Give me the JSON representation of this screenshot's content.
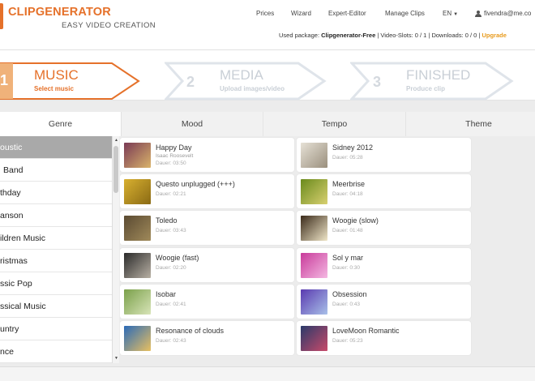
{
  "header": {
    "logo_title": "CLIPGENERATOR",
    "logo_subtitle": "EASY VIDEO CREATION",
    "nav": [
      "Prices",
      "Wizard",
      "Expert-Editor",
      "Manage Clips"
    ],
    "language": "EN",
    "user_email": "fivendra@me.co",
    "package_label": "Used package:",
    "package_name": "Clipgenerator-Free",
    "slots_text": "| Video-Slots: 0 / 1 | Downloads: 0 / 0 |",
    "upgrade_label": "Upgrade"
  },
  "steps": [
    {
      "number": "1",
      "title": "MUSIC",
      "subtitle": "Select music",
      "active": true
    },
    {
      "number": "2",
      "title": "MEDIA",
      "subtitle": "Upload images/video",
      "active": false
    },
    {
      "number": "3",
      "title": "FINISHED",
      "subtitle": "Produce clip",
      "active": false
    }
  ],
  "filters": [
    "Genre",
    "Mood",
    "Tempo",
    "Theme"
  ],
  "genres": [
    {
      "label": "oustic",
      "selected": true
    },
    {
      "label": "Band",
      "selected": false
    },
    {
      "label": "thday",
      "selected": false
    },
    {
      "label": "anson",
      "selected": false
    },
    {
      "label": "ildren Music",
      "selected": false
    },
    {
      "label": "ristmas",
      "selected": false
    },
    {
      "label": "ssic Pop",
      "selected": false
    },
    {
      "label": "ssical Music",
      "selected": false
    },
    {
      "label": "untry",
      "selected": false
    },
    {
      "label": "nce",
      "selected": false
    }
  ],
  "clips": [
    {
      "title": "Happy Day",
      "artist": "Isaac Roosevelt",
      "duration": "Dauer: 03:50",
      "thumb_colors": [
        "#7a3a55",
        "#d9b36a"
      ]
    },
    {
      "title": "Sidney 2012",
      "artist": "",
      "duration": "Dauer: 05:28",
      "thumb_colors": [
        "#e6e1d6",
        "#9a8f7d"
      ]
    },
    {
      "title": "Questo unplugged (+++)",
      "artist": "",
      "duration": "Dauer: 02:21",
      "thumb_colors": [
        "#d8b030",
        "#8a6a14"
      ]
    },
    {
      "title": "Meerbrise",
      "artist": "",
      "duration": "Dauer: 04:18",
      "thumb_colors": [
        "#6a8a1c",
        "#d8d070"
      ]
    },
    {
      "title": "Toledo",
      "artist": "",
      "duration": "Dauer: 03:43",
      "thumb_colors": [
        "#5a4a32",
        "#a08a5a"
      ]
    },
    {
      "title": "Woogie (slow)",
      "artist": "",
      "duration": "Dauer: 01:48",
      "thumb_colors": [
        "#3a2a1a",
        "#f0e6c8"
      ]
    },
    {
      "title": "Woogie (fast)",
      "artist": "",
      "duration": "Dauer: 02:20",
      "thumb_colors": [
        "#2a2a2a",
        "#b8b0a4"
      ]
    },
    {
      "title": "Sol y mar",
      "artist": "",
      "duration": "Dauer: 0:30",
      "thumb_colors": [
        "#c83a9a",
        "#f4b8e2"
      ]
    },
    {
      "title": "Isobar",
      "artist": "",
      "duration": "Dauer: 02:41",
      "thumb_colors": [
        "#7aa04a",
        "#d8e4b8"
      ]
    },
    {
      "title": "Obsession",
      "artist": "",
      "duration": "Dauer: 0:43",
      "thumb_colors": [
        "#5a3ab0",
        "#a8c0e8"
      ]
    },
    {
      "title": "Resonance of clouds",
      "artist": "",
      "duration": "Dauer: 02:43",
      "thumb_colors": [
        "#2a6ab8",
        "#e8c060"
      ]
    },
    {
      "title": "LoveMoon Romantic",
      "artist": "",
      "duration": "Dauer: 05:23",
      "thumb_colors": [
        "#2a3a6a",
        "#c84a6a"
      ]
    }
  ],
  "colors": {
    "accent": "#e5712a",
    "upgrade": "#e89a1c",
    "step_inactive": "#dfe4ea",
    "step_inactive_text": "#c9cfd6",
    "selected_genre": "#a9a9a9"
  }
}
